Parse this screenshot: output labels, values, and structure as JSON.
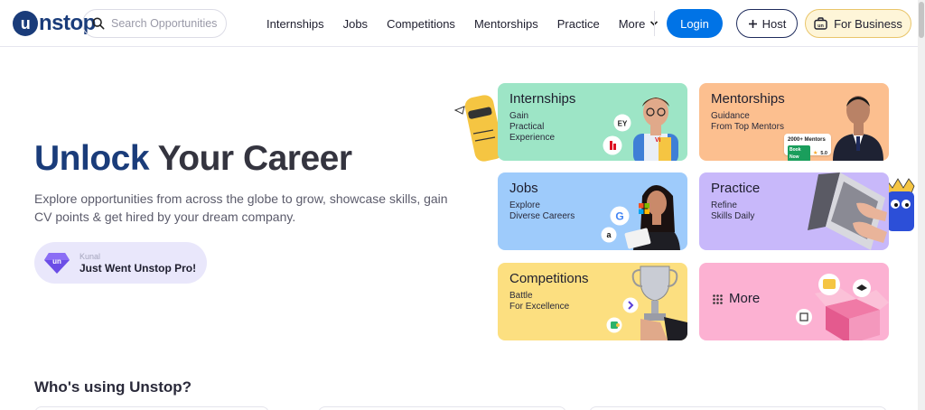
{
  "header": {
    "logo_text": "nstop",
    "logo_mark": "u",
    "search_placeholder": "Search Opportunities",
    "nav": [
      {
        "label": "Internships"
      },
      {
        "label": "Jobs"
      },
      {
        "label": "Competitions"
      },
      {
        "label": "Mentorships"
      },
      {
        "label": "Practice"
      },
      {
        "label": "More"
      }
    ],
    "login_label": "Login",
    "host_label": "Host",
    "business_label": "For Business"
  },
  "hero": {
    "title_highlight": "Unlock",
    "title_rest": " Your Career",
    "description": "Explore opportunities from across the globe to grow, showcase skills, gain CV points & get hired by your dream company.",
    "pro_name": "Kunal",
    "pro_message": "Just Went Unstop Pro!"
  },
  "cards": {
    "internships": {
      "title": "Internships",
      "subtitle": "Gain\nPractical\nExperience",
      "badge1": "EY",
      "badge2": "Vi"
    },
    "mentorships": {
      "title": "Mentorships",
      "subtitle": "Guidance\nFrom Top Mentors",
      "mentor_count": "2000+ Mentors",
      "book_label": "Book Now",
      "rating": "5.0"
    },
    "jobs": {
      "title": "Jobs",
      "subtitle": "Explore\nDiverse Careers",
      "badge_g": "G",
      "badge_a": "a"
    },
    "practice": {
      "title": "Practice",
      "subtitle": "Refine\nSkills Daily"
    },
    "competitions": {
      "title": "Competitions",
      "subtitle": "Battle\nFor Excellence"
    },
    "more": {
      "title": "More"
    }
  },
  "section": {
    "whos_using": "Who's using Unstop?"
  },
  "colors": {
    "brand": "#1a3c7a",
    "login": "#0073e6",
    "internships": "#9de5c6",
    "mentorships": "#fcbf8f",
    "jobs": "#9ecbfb",
    "practice": "#c8b8fa",
    "competitions": "#fcdf80",
    "more": "#fcb1d2"
  }
}
